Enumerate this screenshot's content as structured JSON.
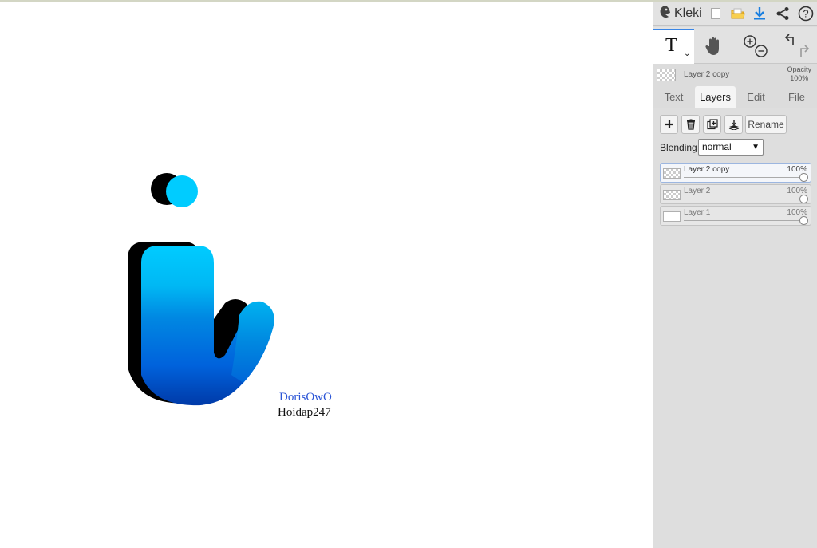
{
  "canvas": {
    "signature_1": "DorisOwO",
    "signature_2": "Hoidap247",
    "colors": {
      "shadow": "#000000",
      "cyan": "#00ccff",
      "blue_mid": "#0081e6",
      "blue_dark": "#0050d8",
      "signature_blue": "#2b55d6"
    }
  },
  "toolbar": {
    "app_name": "Kleki",
    "icons": [
      "logo-icon",
      "new-image-icon",
      "open-image-icon",
      "download-icon",
      "share-icon",
      "help-icon"
    ],
    "tool_glyph": "T",
    "tools": [
      "text-tool-icon",
      "hand-tool-icon",
      "zoom-in-icon",
      "zoom-out-icon",
      "undo-icon",
      "redo-icon"
    ]
  },
  "active_layer": {
    "name": "Layer 2 copy",
    "opacity_label": "Opacity",
    "opacity_value": "100%"
  },
  "tabs": [
    {
      "label": "Text"
    },
    {
      "label": "Layers"
    },
    {
      "label": "Edit"
    },
    {
      "label": "File"
    }
  ],
  "active_tab": "Layers",
  "layers_panel": {
    "buttons": [
      "add-layer-icon",
      "delete-layer-icon",
      "duplicate-layer-icon",
      "merge-down-icon"
    ],
    "rename_label": "Rename",
    "blending_label": "Blending",
    "blending_value": "normal",
    "layers": [
      {
        "name": "Layer 2 copy",
        "opacity": "100%",
        "opacity_fraction": 1.0
      },
      {
        "name": "Layer 2",
        "opacity": "100%",
        "opacity_fraction": 1.0
      },
      {
        "name": "Layer 1",
        "opacity": "100%",
        "opacity_fraction": 1.0
      }
    ]
  }
}
